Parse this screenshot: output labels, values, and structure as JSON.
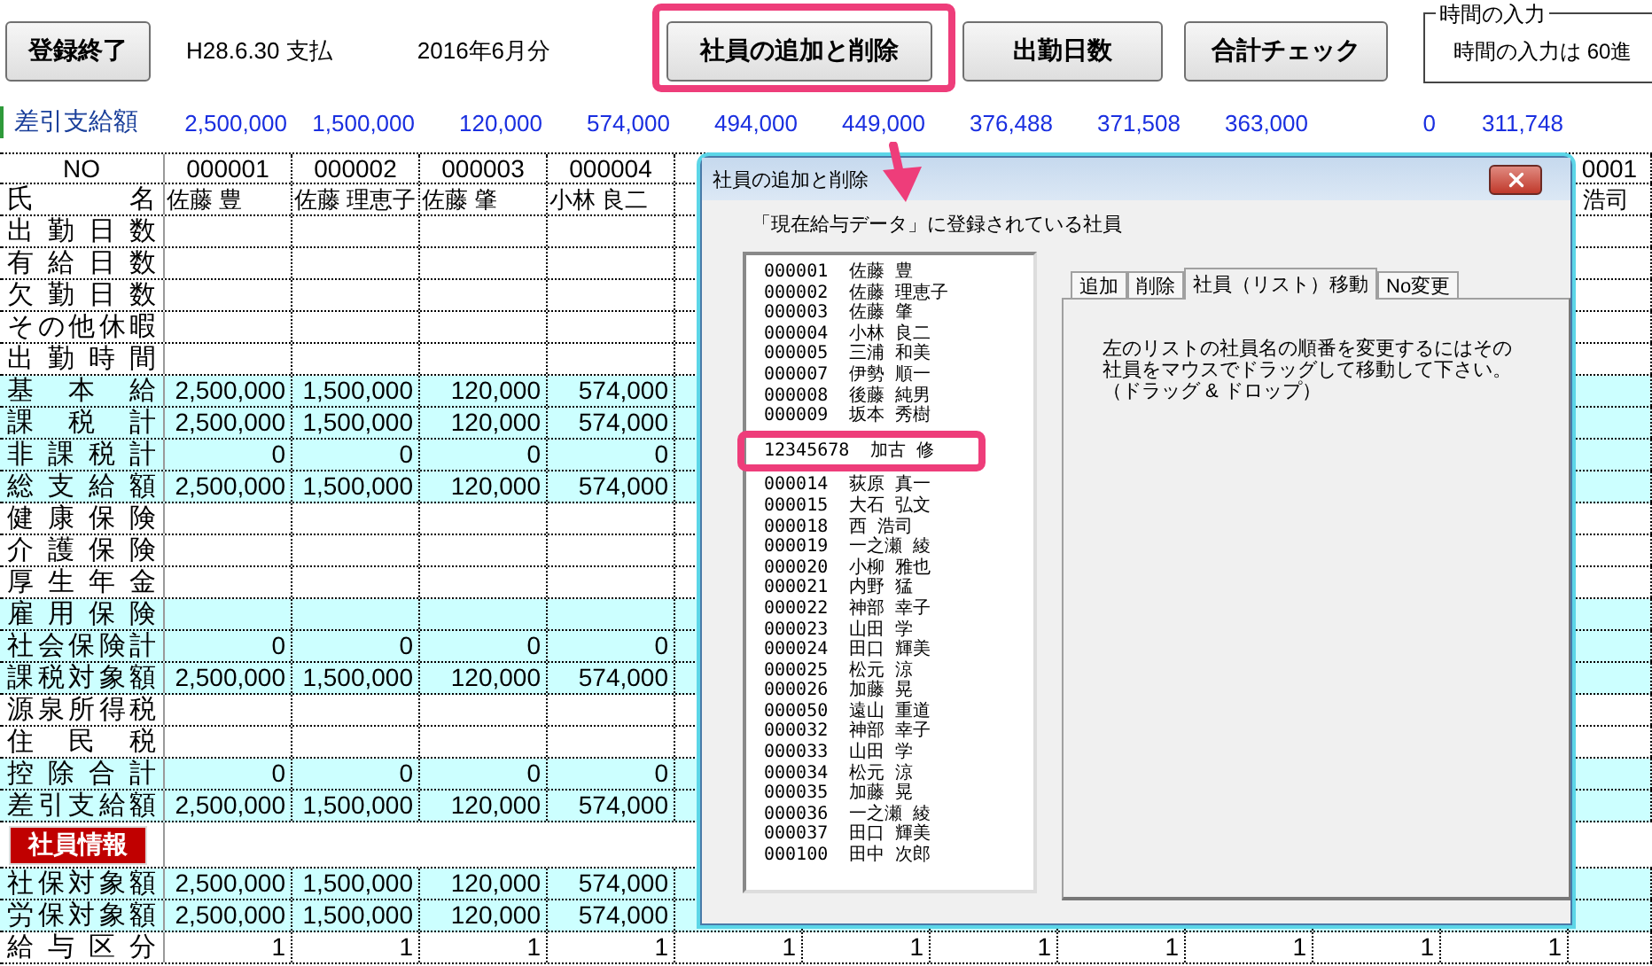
{
  "toolbar": {
    "finish_button": "登録終了",
    "payment_date": "H28.6.30 支払",
    "period": "2016年6月分",
    "buttons": [
      "社員の追加と削除",
      "出勤日数",
      "合計チェック"
    ],
    "time_input": {
      "legend": "時間の入力",
      "text": "時間の入力は 60進"
    }
  },
  "summary_row": {
    "label": "差引支給額",
    "values": [
      "2,500,000",
      "1,500,000",
      "120,000",
      "574,000",
      "494,000",
      "449,000",
      "376,488",
      "371,508",
      "363,000",
      "0",
      "311,748"
    ]
  },
  "sheet": {
    "header_label": "NO",
    "name_label": "氏名",
    "columns": [
      {
        "no": "000001",
        "name": "佐藤 豊"
      },
      {
        "no": "000002",
        "name": "佐藤 理恵子"
      },
      {
        "no": "000003",
        "name": "佐藤 肇"
      },
      {
        "no": "000004",
        "name": "小林 良二"
      },
      {},
      {},
      {},
      {},
      {},
      {},
      {},
      {
        "no": "0001",
        "name": "浩司"
      }
    ],
    "rows": [
      {
        "label": "出勤日数",
        "shaded": false
      },
      {
        "label": "有給日数",
        "shaded": false
      },
      {
        "label": "欠勤日数",
        "shaded": false
      },
      {
        "label": "その他休暇",
        "shaded": false
      },
      {
        "label": "出勤時間",
        "shaded": false
      },
      {
        "label": "基本給",
        "shaded": true,
        "values": [
          "2,500,000",
          "1,500,000",
          "120,000",
          "574,000"
        ]
      },
      {
        "label": "課税計",
        "shaded": true,
        "values": [
          "2,500,000",
          "1,500,000",
          "120,000",
          "574,000"
        ]
      },
      {
        "label": "非課税計",
        "shaded": true,
        "values": [
          "0",
          "0",
          "0",
          "0"
        ]
      },
      {
        "label": "総支給額",
        "shaded": true,
        "values": [
          "2,500,000",
          "1,500,000",
          "120,000",
          "574,000"
        ]
      },
      {
        "label": "健康保険",
        "shaded": false
      },
      {
        "label": "介護保険",
        "shaded": false
      },
      {
        "label": "厚生年金",
        "shaded": false
      },
      {
        "label": "雇用保険",
        "shaded": true
      },
      {
        "label": "社会保険計",
        "shaded": true,
        "values": [
          "0",
          "0",
          "0",
          "0"
        ]
      },
      {
        "label": "課税対象額",
        "shaded": true,
        "values": [
          "2,500,000",
          "1,500,000",
          "120,000",
          "574,000"
        ]
      },
      {
        "label": "源泉所得税",
        "shaded": false
      },
      {
        "label": "住民税",
        "shaded": false
      },
      {
        "label": "控除合計",
        "shaded": true,
        "values": [
          "0",
          "0",
          "0",
          "0"
        ]
      },
      {
        "label": "差引支給額",
        "shaded": true,
        "values": [
          "2,500,000",
          "1,500,000",
          "120,000",
          "574,000"
        ]
      }
    ],
    "section_badge": "社員情報",
    "lower_rows": [
      {
        "label": "社保対象額",
        "shaded": true,
        "values": [
          "2,500,000",
          "1,500,000",
          "120,000",
          "574,000"
        ]
      },
      {
        "label": "労保対象額",
        "shaded": true,
        "values": [
          "2,500,000",
          "1,500,000",
          "120,000",
          "574,000"
        ]
      },
      {
        "label": "給与区分",
        "shaded": false,
        "values": [
          "1",
          "1",
          "1",
          "1",
          "1",
          "1",
          "1",
          "1",
          "1",
          "1",
          "1"
        ]
      }
    ]
  },
  "dialog": {
    "title": "社員の追加と削除",
    "list_caption": "「現在給与データ」に登録されている社員",
    "employees": [
      {
        "text": "000001  佐藤 豊",
        "annotated": false
      },
      {
        "text": "000002  佐藤 理恵子",
        "annotated": false
      },
      {
        "text": "000003  佐藤 肇",
        "annotated": false
      },
      {
        "text": "000004  小林 良二",
        "annotated": false
      },
      {
        "text": "000005  三浦 和美",
        "annotated": false
      },
      {
        "text": "000007  伊勢 順一",
        "annotated": false
      },
      {
        "text": "000008  後藤 純男",
        "annotated": false
      },
      {
        "text": "000009  坂本 秀樹",
        "annotated": false
      },
      {
        "text": "12345678  加古 修",
        "annotated": true
      },
      {
        "text": "000014  荻原 真一",
        "annotated": false
      },
      {
        "text": "000015  大石 弘文",
        "annotated": false
      },
      {
        "text": "000018  西 浩司",
        "annotated": false
      },
      {
        "text": "000019  一之瀬 綾",
        "annotated": false
      },
      {
        "text": "000020  小柳 雅也",
        "annotated": false
      },
      {
        "text": "000021  内野 猛",
        "annotated": false
      },
      {
        "text": "000022  神部 幸子",
        "annotated": false
      },
      {
        "text": "000023  山田 学",
        "annotated": false
      },
      {
        "text": "000024  田口 輝美",
        "annotated": false
      },
      {
        "text": "000025  松元 涼",
        "annotated": false
      },
      {
        "text": "000026  加藤 晃",
        "annotated": false
      },
      {
        "text": "000050  遠山 重道",
        "annotated": false
      },
      {
        "text": "000032  神部 幸子",
        "annotated": false
      },
      {
        "text": "000033  山田 学",
        "annotated": false
      },
      {
        "text": "000034  松元 涼",
        "annotated": false
      },
      {
        "text": "000035  加藤 晃",
        "annotated": false
      },
      {
        "text": "000036  一之瀬 綾",
        "annotated": false
      },
      {
        "text": "000037  田口 輝美",
        "annotated": false
      },
      {
        "text": "000100  田中 次郎",
        "annotated": false
      }
    ],
    "tabs": [
      {
        "label": "追加",
        "selected": false
      },
      {
        "label": "削除",
        "selected": false
      },
      {
        "label": "社員（リスト）移動",
        "selected": true
      },
      {
        "label": "No変更",
        "selected": false
      }
    ],
    "instructions": [
      "左のリストの社員名の順番を変更するにはその",
      "社員をマウスでドラッグして移動して下さい。",
      "（ドラッグ & ドロップ）"
    ]
  }
}
